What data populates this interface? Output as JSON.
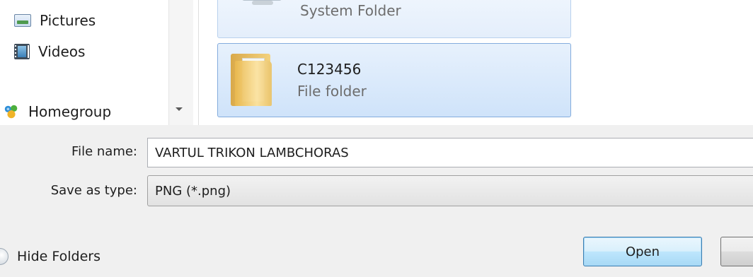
{
  "nav_pane": {
    "items": [
      {
        "label": "Pictures",
        "icon": "pictures-icon"
      },
      {
        "label": "Videos",
        "icon": "videos-icon"
      },
      {
        "label": "Homegroup",
        "icon": "homegroup-icon"
      }
    ]
  },
  "files": [
    {
      "name": "",
      "type": "System Folder",
      "icon": "computer-icon",
      "selected": false
    },
    {
      "name": "C123456",
      "type": "File folder",
      "icon": "folder-icon",
      "selected": true
    }
  ],
  "fields": {
    "file_name_label": "File name:",
    "file_name_value": "VARTUL TRIKON LAMBCHORAS",
    "save_type_label": "Save as type:",
    "save_type_value": "PNG (*.png)"
  },
  "footer": {
    "hide_folders_label": "Hide Folders",
    "open_label": "Open",
    "cancel_label": ""
  },
  "colors": {
    "selection_border": "#84acdd",
    "selection_fill": "#cfe3fa",
    "panel_bg": "#f0f0f0",
    "default_button_border": "#3c7fb1"
  }
}
